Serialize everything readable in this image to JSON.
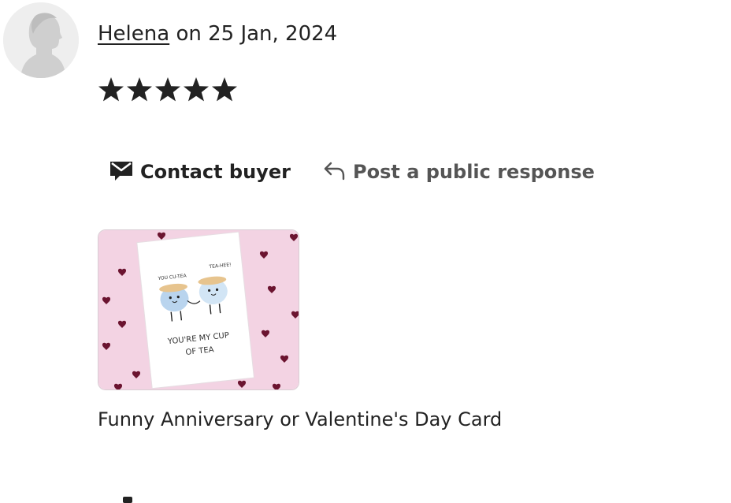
{
  "review": {
    "reviewer_name": "Helena",
    "date_text": " on 25 Jan, 2024",
    "rating": 5,
    "rating_max": 5
  },
  "actions": {
    "contact_buyer": "Contact buyer",
    "public_response": "Post a public response"
  },
  "product": {
    "title": "Funny Anniversary or Valentine's Day Card",
    "image_text_top_left": "YOU CU-TEA",
    "image_text_top_right": "TEA-HEE!",
    "image_text_line1": "YOU'RE MY CUP",
    "image_text_line2": "OF TEA"
  },
  "colors": {
    "text": "#222222",
    "muted": "#555555",
    "card_background": "#f3d3e3",
    "heart": "#6b1430"
  },
  "icons": {
    "contact": "envelope-message-icon",
    "public": "reply-arrow-icon",
    "star": "star-icon"
  }
}
